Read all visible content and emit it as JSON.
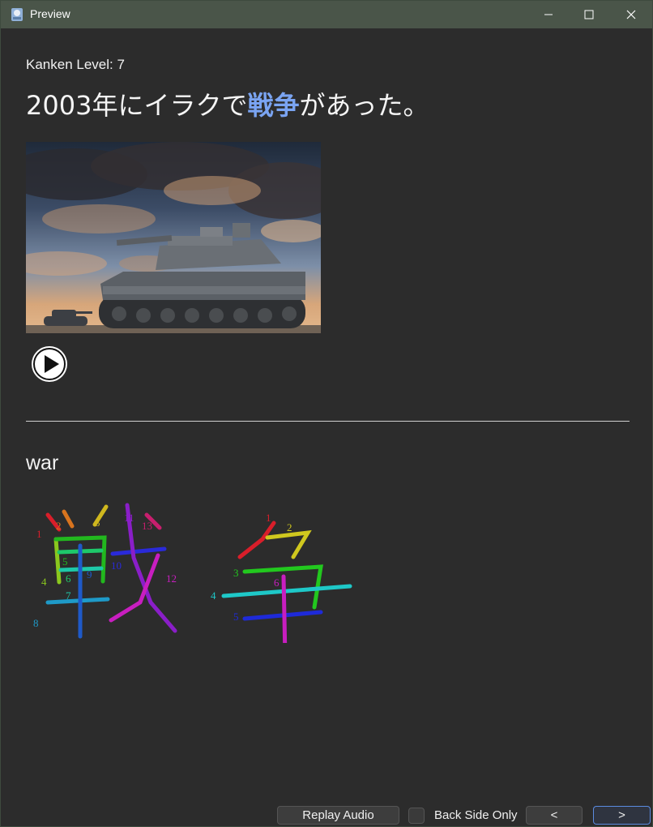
{
  "window": {
    "title": "Preview"
  },
  "card": {
    "kanken_label": "Kanken Level: 7",
    "sentence_before": "2003年にイラクで",
    "sentence_highlight": "戦争",
    "sentence_after": "があった。",
    "meaning": "war",
    "kanji": [
      {
        "char": "戦",
        "stroke_count": 13
      },
      {
        "char": "争",
        "stroke_count": 6
      }
    ]
  },
  "footer": {
    "replay_label": "Replay Audio",
    "back_side_label": "Back Side Only",
    "back_side_checked": false,
    "prev_label": "<",
    "next_label": ">"
  },
  "icons": {
    "app": "app-icon",
    "minimize": "minimize-icon",
    "maximize": "maximize-icon",
    "close": "close-icon",
    "play": "play-icon"
  },
  "colors": {
    "highlight": "#7aa4f2",
    "background": "#2c2c2c",
    "titlebar": "#4a5549"
  }
}
